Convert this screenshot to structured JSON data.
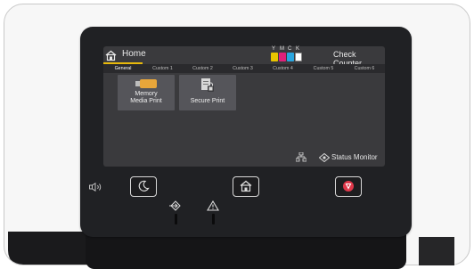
{
  "screen": {
    "home_title": "Home",
    "check_counter": "Check Counter",
    "toner_letters": [
      "Y",
      "M",
      "C",
      "K"
    ],
    "toner_colors": {
      "Y": "#e8c400",
      "M": "#e0217a",
      "C": "#2aa6e0",
      "K": "#ffffff"
    },
    "tabs": [
      "General",
      "Custom 1",
      "Custom 2",
      "Custom 3",
      "Custom 4",
      "Custom 5",
      "Custom 6"
    ],
    "active_tab": "General",
    "tab_accent_color": "#e8b90b",
    "tiles": [
      {
        "line1": "Memory",
        "line2": "Media Print",
        "icon": "usb-memory-icon"
      },
      {
        "line1": "Secure Print",
        "line2": "",
        "icon": "secure-print-icon"
      }
    ],
    "status_monitor": "Status Monitor"
  },
  "hardware": {
    "buttons": [
      {
        "name": "energy-saver-button",
        "icon": "moon-icon"
      },
      {
        "name": "home-button",
        "icon": "home-icon"
      },
      {
        "name": "stop-button",
        "icon": "stop-icon",
        "color": "#e0384a"
      }
    ],
    "indicators": [
      "data-indicator-icon",
      "error-indicator-icon"
    ],
    "panel_color": "#202124",
    "screen_color": "#3a3a3d"
  }
}
